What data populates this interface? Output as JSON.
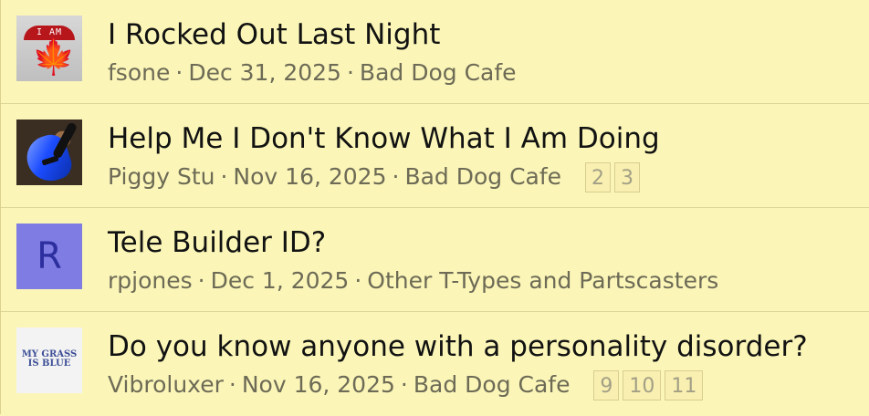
{
  "threads": [
    {
      "title": "I Rocked Out Last Night",
      "author": "fsone",
      "date": "Dec 31, 2025",
      "forum": "Bad Dog Cafe",
      "separator": "·",
      "avatar": {
        "type": "image",
        "banner_text": "I AM",
        "icon": "maple-leaf"
      }
    },
    {
      "title": "Help Me I Don't Know What I Am Doing",
      "author": "Piggy Stu",
      "date": "Nov 16, 2025",
      "forum": "Bad Dog Cafe",
      "separator": "·",
      "pages": [
        "2",
        "3"
      ],
      "avatar": {
        "type": "image",
        "icon": "guitar"
      }
    },
    {
      "title": "Tele Builder ID?",
      "author": "rpjones",
      "date": "Dec 1, 2025",
      "forum": "Other T-Types and Partscasters",
      "separator": "·",
      "avatar": {
        "type": "letter",
        "letter": "R",
        "background": "#7f7de3",
        "color": "#2d2f9f"
      }
    },
    {
      "title": "Do you know anyone with a personality disorder?",
      "author": "Vibroluxer",
      "date": "Nov 16, 2025",
      "forum": "Bad Dog Cafe",
      "separator": "·",
      "pages": [
        "9",
        "10",
        "11"
      ],
      "avatar": {
        "type": "text",
        "line1": "MY GRASS",
        "line2": "IS BLUE",
        "color": "#3d4f96"
      }
    }
  ],
  "colors": {
    "background": "#fbf6b8",
    "divider": "#ddd596",
    "title": "#121212",
    "meta": "#6d6a56",
    "page_link_text": "#a39f86"
  }
}
